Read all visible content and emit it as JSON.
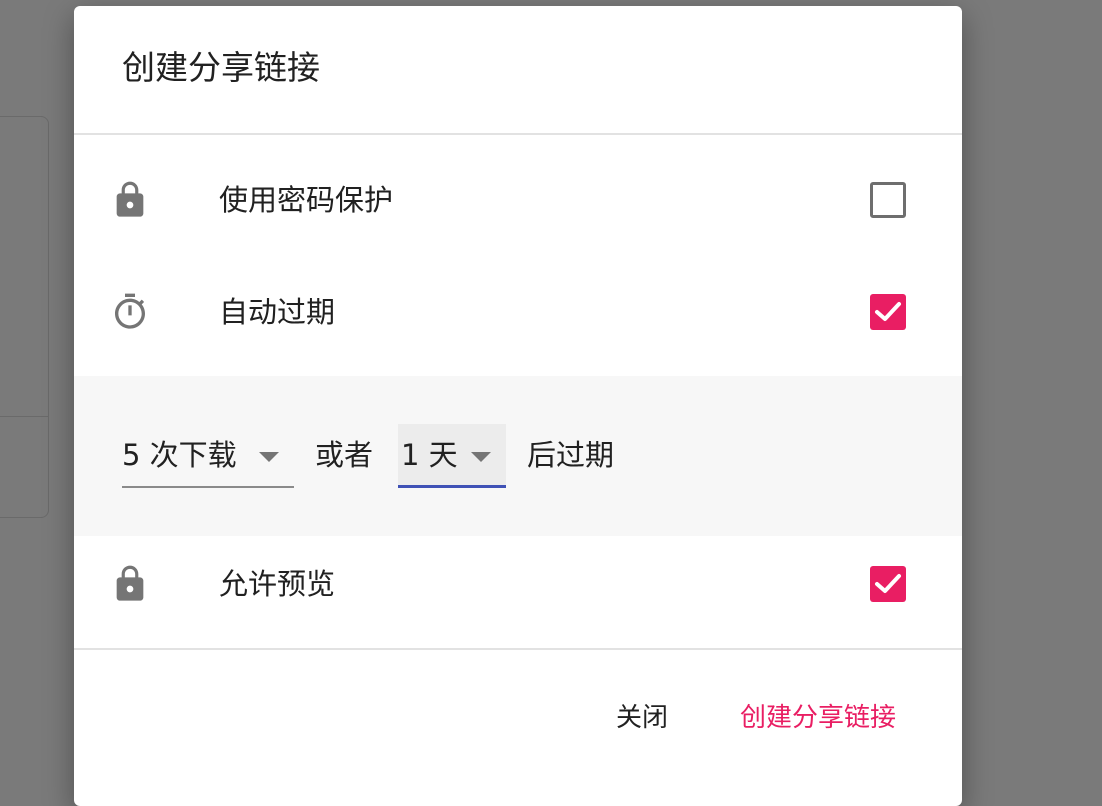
{
  "dialog": {
    "title": "创建分享链接"
  },
  "options": [
    {
      "label": "使用密码保护",
      "icon": "lock-icon",
      "checked": false
    },
    {
      "label": "自动过期",
      "icon": "timer-icon",
      "checked": true
    },
    {
      "label": "允许预览",
      "icon": "lock-icon",
      "checked": true
    }
  ],
  "expiry": {
    "downloads_value": "5 次下载",
    "or_text": "或者",
    "days_value": "1 天",
    "after_text": "后过期"
  },
  "actions": {
    "close_label": "关闭",
    "create_label": "创建分享链接"
  },
  "colors": {
    "accent": "#e91e63",
    "focus_underline": "#3f51b5",
    "icon": "#757575",
    "overlay": "#7a7a7a"
  }
}
